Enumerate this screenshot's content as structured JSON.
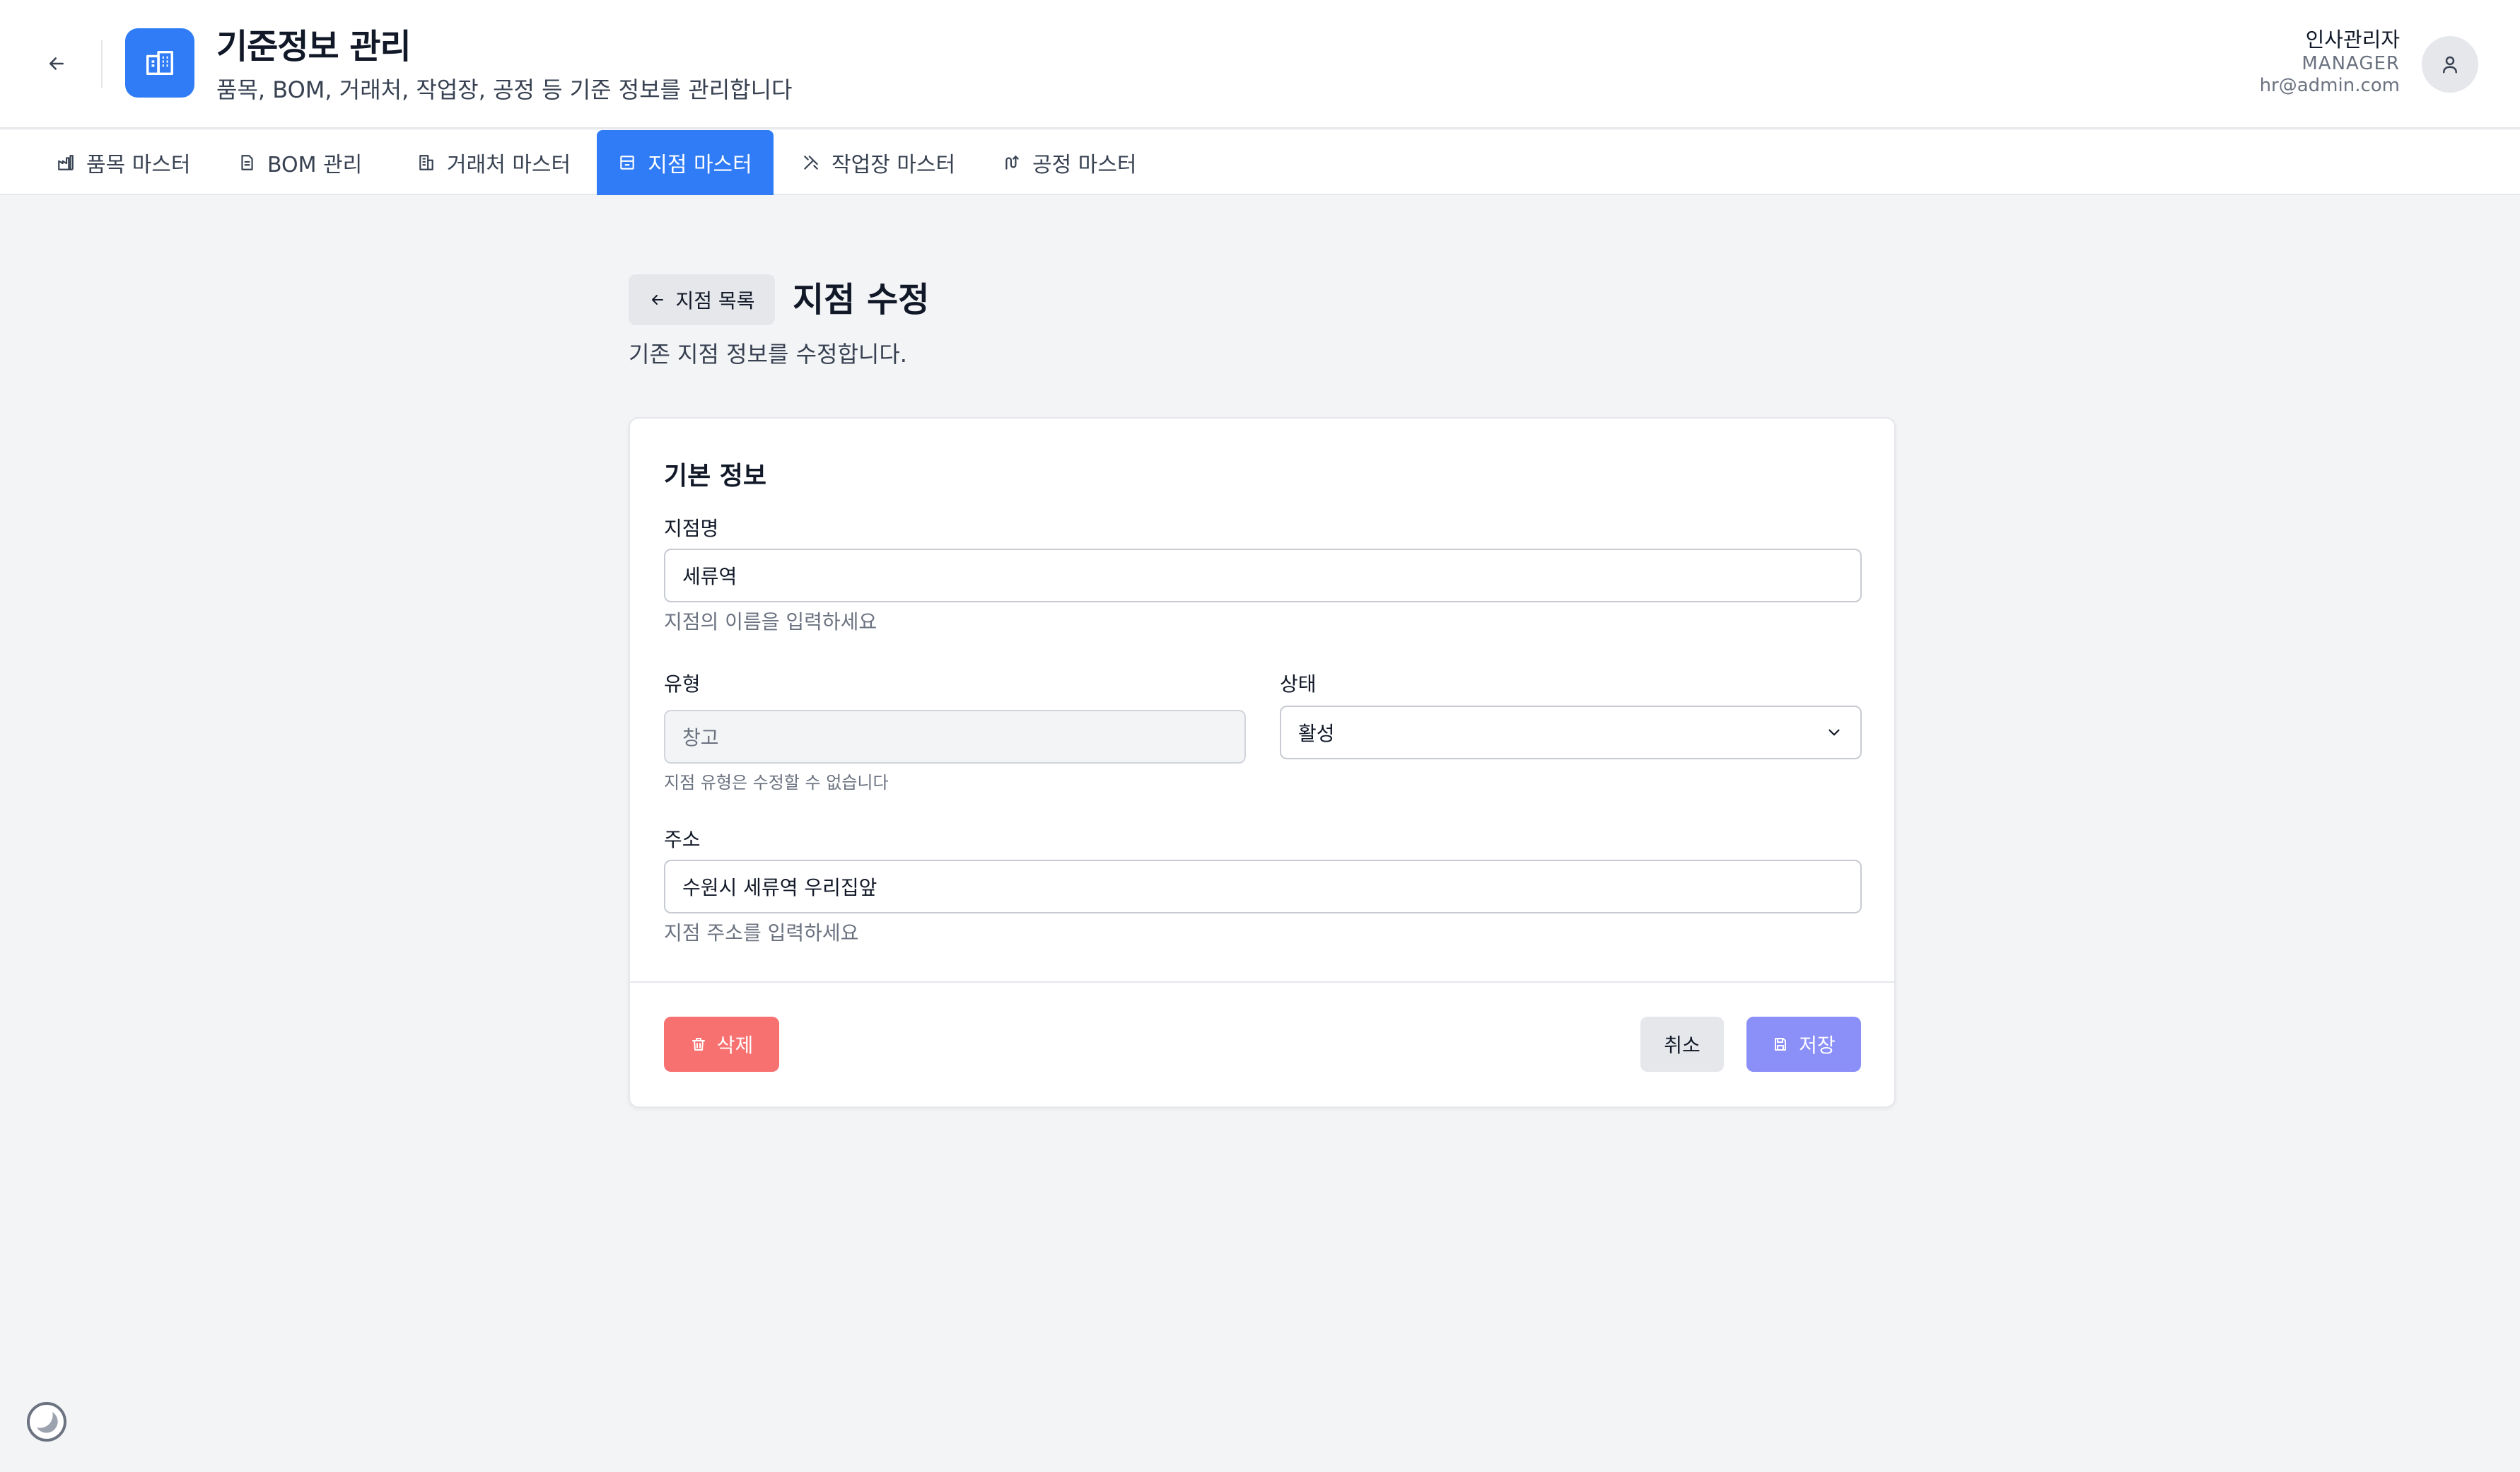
{
  "header": {
    "title": "기준정보 관리",
    "subtitle": "품목, BOM, 거래처, 작업장, 공정 등 기준 정보를 관리합니다",
    "user": {
      "name": "인사관리자",
      "role": "MANAGER",
      "email": "hr@admin.com"
    }
  },
  "tabs": [
    {
      "label": "품목 마스터",
      "icon": "factory-icon",
      "active": false
    },
    {
      "label": "BOM 관리",
      "icon": "document-icon",
      "active": false
    },
    {
      "label": "거래처 마스터",
      "icon": "building-icon",
      "active": false
    },
    {
      "label": "지점 마스터",
      "icon": "store-icon",
      "active": true
    },
    {
      "label": "작업장 마스터",
      "icon": "tools-icon",
      "active": false
    },
    {
      "label": "공정 마스터",
      "icon": "route-icon",
      "active": false
    }
  ],
  "page": {
    "back_label": "지점 목록",
    "title": "지점 수정",
    "description": "기존 지점 정보를 수정합니다."
  },
  "form": {
    "section_title": "기본 정보",
    "name": {
      "label": "지점명",
      "value": "세류역",
      "help": "지점의 이름을 입력하세요"
    },
    "type": {
      "label": "유형",
      "value": "창고",
      "help": "지점 유형은 수정할 수 없습니다"
    },
    "status": {
      "label": "상태",
      "value": "활성"
    },
    "address": {
      "label": "주소",
      "value": "수원시 세류역 우리집앞",
      "help": "지점 주소를 입력하세요"
    },
    "buttons": {
      "delete": "삭제",
      "cancel": "취소",
      "save": "저장"
    }
  },
  "colors": {
    "primary": "#2f7cf6",
    "danger": "#f87171",
    "save": "#8b8ff8",
    "background": "#f3f4f6"
  }
}
